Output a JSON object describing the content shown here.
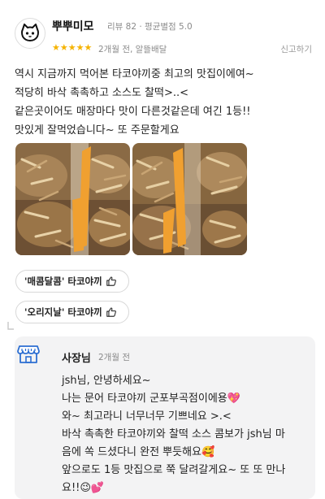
{
  "review": {
    "reviewer_name": "뿌뿌미모",
    "reviewer_meta": "리뷰 82 · 평균별점 5.0",
    "rating": 5,
    "stars": "★★★★★",
    "date_line": "2개월 전, 알뜰배달",
    "report_label": "신고하기",
    "text_lines": [
      "역시 지금까지 먹어본 타코야끼중 최고의 맛집이에여~",
      "적당히 바삭 촉촉하고 소스도 찰떡>..<",
      "같은곳이어도 매장마다 맛이 다른것같은데 여긴 1등!!",
      "맛있게 잘먹었습니다~ 또 주문할게요"
    ],
    "menu_tags": [
      "'매콤달콤' 타코야끼",
      "'오리지날' 타코야끼"
    ]
  },
  "reply": {
    "owner_name": "사장님",
    "date": "2개월 전",
    "lines": [
      "jsh님, 안녕하세요~",
      "나는 문어 타코야끼 군포부곡점이에용💖",
      "와~ 최고라니 너무너무 기쁘네요 >.<",
      "바삭 촉촉한 타코야끼와 찰떡 소스 콤보가 jsh님 마",
      "음에 쏙 드셨다니 완전 뿌듯해요🥰",
      "앞으로도 1등 맛집으로 쭉 달려갈게요~ 또 또 만나",
      "요!!😉💕"
    ]
  },
  "icons": {
    "avatar": "cat-face-icon",
    "thumb": "thumbs-up-icon",
    "shop": "storefront-icon",
    "reply_arrow": "reply-corner-icon"
  },
  "colors": {
    "star": "#f5b301",
    "shop_icon": "#2d6fd2",
    "reply_bg": "#f3f3f4",
    "chopstick": "#f0a030"
  }
}
